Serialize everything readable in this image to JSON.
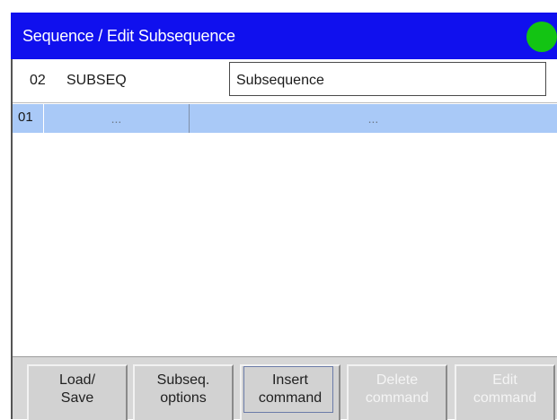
{
  "title": "Sequence / Edit Subsequence",
  "status_color": "#13c413",
  "subsequence": {
    "number": "02",
    "label": "SUBSEQ",
    "name": "Subsequence"
  },
  "commands": [
    {
      "index": "01",
      "col1": "...",
      "col2": "..."
    }
  ],
  "toolbar": {
    "load_save": "Load/\nSave",
    "subseq_options": "Subseq.\noptions",
    "insert_command": "Insert\ncommand",
    "delete_command": "Delete\ncommand",
    "edit_command": "Edit\ncommand"
  }
}
